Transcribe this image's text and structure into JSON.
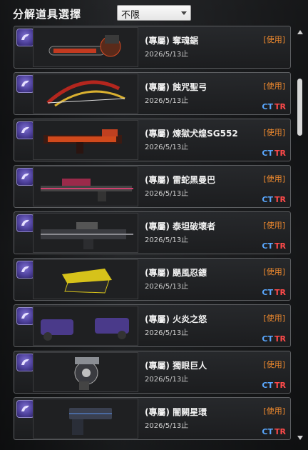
{
  "header": {
    "title": "分解道具選擇",
    "filter": {
      "selected": "不限"
    }
  },
  "items": [
    {
      "name": "(專屬) 奪魂鋸",
      "date": "2026/5/13止",
      "status": "[使用]",
      "ct": "",
      "tr": "",
      "icon": "chainsaw-icon",
      "color": "#c33a20"
    },
    {
      "name": "(專屬) 蝕咒聖弓",
      "date": "2026/5/13止",
      "status": "[使用]",
      "ct": "CT",
      "tr": "TR",
      "icon": "bow-icon",
      "color": "#b3261e"
    },
    {
      "name": "(專屬) 煉獄犬煌SG552",
      "date": "2026/5/13止",
      "status": "[使用]",
      "ct": "CT",
      "tr": "TR",
      "icon": "rifle-icon",
      "color": "#d0491c"
    },
    {
      "name": "(專屬) 雷蛇黑曼巴",
      "date": "2026/5/13止",
      "status": "[使用]",
      "ct": "CT",
      "tr": "TR",
      "icon": "sniper-icon",
      "color": "#b0305a"
    },
    {
      "name": "(專屬) 泰坦破壞者",
      "date": "2026/5/13止",
      "status": "[使用]",
      "ct": "CT",
      "tr": "TR",
      "icon": "machine-gun-icon",
      "color": "#6e7078"
    },
    {
      "name": "(專屬) 颶風忍鏢",
      "date": "2026/5/13止",
      "status": "[使用]",
      "ct": "CT",
      "tr": "TR",
      "icon": "shuriken-icon",
      "color": "#d6c21a"
    },
    {
      "name": "(專屬) 火炎之怒",
      "date": "2026/5/13止",
      "status": "[使用]",
      "ct": "CT",
      "tr": "TR",
      "icon": "dual-pistols-icon",
      "color": "#7b5fd0"
    },
    {
      "name": "(專屬) 獨眼巨人",
      "date": "2026/5/13止",
      "status": "[使用]",
      "ct": "CT",
      "tr": "TR",
      "icon": "cannon-icon",
      "color": "#8a8d93"
    },
    {
      "name": "(專屬) 闇闕星環",
      "date": "2026/5/13止",
      "status": "[使用]",
      "ct": "CT",
      "tr": "TR",
      "icon": "pistol-icon",
      "color": "#4a6aa0"
    }
  ]
}
